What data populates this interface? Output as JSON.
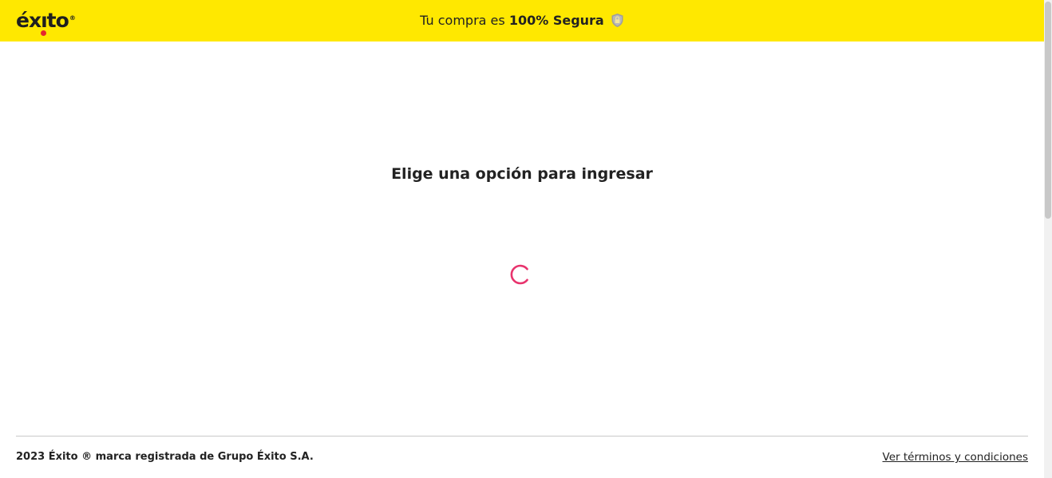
{
  "header": {
    "logo_text": "éxito",
    "logo_registered": "®",
    "secure_prefix": "Tu compra es ",
    "secure_bold": "100% Segura",
    "secure_icon": "shield-lock-icon",
    "background_color": "#ffe800"
  },
  "main": {
    "title": "Elige una opción para ingresar",
    "spinner_color": "#e8336d"
  },
  "footer": {
    "copyright": "2023 Éxito ® marca registrada de Grupo Éxito S.A.",
    "terms_link": "Ver términos y condiciones"
  }
}
